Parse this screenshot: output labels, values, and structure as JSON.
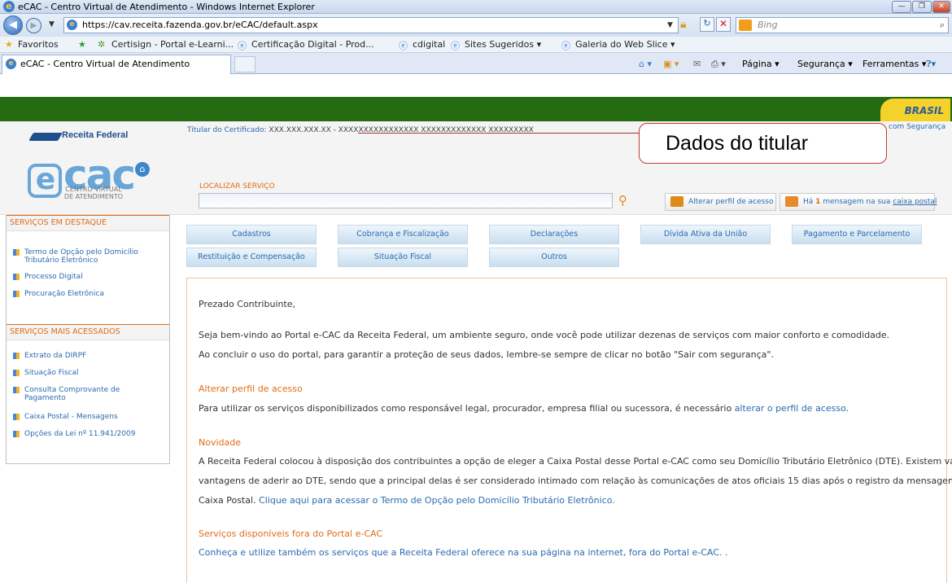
{
  "window": {
    "title": "eCAC - Centro Virtual de Atendimento - Windows Internet Explorer",
    "url": "https://cav.receita.fazenda.gov.br/eCAC/default.aspx",
    "search_placeholder": "Bing"
  },
  "favorites": {
    "label": "Favoritos",
    "items": [
      "Certisign - Portal e-Learni...",
      "Certificação Digital - Prod...",
      "cdigital",
      "Sites Sugeridos ▾",
      "Galeria do Web Slice ▾"
    ]
  },
  "tab": {
    "label": "eCAC - Centro Virtual de Atendimento"
  },
  "tools": {
    "page": "Página ▾",
    "security": "Segurança ▾",
    "tools": "Ferramentas ▾"
  },
  "site": {
    "brasil": "BRASIL",
    "receita": "Receita Federal",
    "ecac_logo": "cac",
    "centro": "CENTRO VIRTUAL\nDE ATENDIMENTO",
    "titular_label": "Titular do Certificado:",
    "titular_value": "XXX.XXX.XXX.XX - XXXXXXXXXXXXXXXX XXXXXXXXXXXXX XXXXXXXXX",
    "sair": "com Segurança",
    "callout": "Dados do titular"
  },
  "search": {
    "label": "LOCALIZAR SERVIÇO",
    "value": ""
  },
  "header_buttons": {
    "profile": "Alterar perfil de acesso",
    "mail_pre": "Há",
    "mail_count": "1",
    "mail_mid": "mensagem na sua",
    "mail_link": "caixa postal"
  },
  "sidebar": {
    "section1": "SERVIÇOS EM DESTAQUE",
    "items1": [
      "Termo de Opção pelo Domicílio Tributário Eletrônico",
      "Processo Digital",
      "Procuração Eletrônica"
    ],
    "section2": "SERVIÇOS MAIS ACESSADOS",
    "items2": [
      "Extrato da DIRPF",
      "Situação Fiscal",
      "Consulta Comprovante de Pagamento",
      "Caixa Postal - Mensagens",
      "Opções da Lei nº 11.941/2009"
    ]
  },
  "menu": {
    "row1": [
      "Cadastros",
      "Cobrança e Fiscalização",
      "Declarações",
      "Dívida Ativa da União",
      "Pagamento e Parcelamento"
    ],
    "row2": [
      "Restituição e Compensação",
      "Situação Fiscal",
      "Outros"
    ]
  },
  "content": {
    "greeting": "Prezado Contribuinte,",
    "p1": "Seja bem-vindo ao Portal e-CAC da Receita Federal, um ambiente seguro, onde você pode utilizar dezenas de serviços com maior conforto e comodidade.",
    "p2": "Ao concluir o uso do portal, para garantir a proteção de seus dados, lembre-se sempre de clicar no botão \"Sair com segurança\".",
    "h1": "Alterar perfil de acesso",
    "p3": "Para utilizar os serviços disponibilizados como responsável legal, procurador, empresa filial ou sucessora, é necessário",
    "p3_link": "alterar o perfil de acesso",
    "h2": "Novidade",
    "p4a": "A Receita Federal colocou à disposição dos contribuintes a opção de eleger a Caixa Postal desse Portal e-CAC como seu Domicílio Tributário Eletrônico (DTE). Existem várias",
    "p4b": "vantagens de aderir ao DTE, sendo que a principal delas é ser considerado intimado com relação às comunicações de atos oficiais 15 dias após o registro da mensagem na",
    "p4c": "Caixa Postal.",
    "p4_link": "Clique aqui para acessar o Termo de Opção pelo Domicílio Tributário Eletrônico.",
    "h3": "Serviços disponíveis fora do Portal e-CAC",
    "p5_link": "Conheça e utilize também os serviços que a Receita Federal oferece na sua página na internet, fora do Portal e-CAC. ."
  },
  "colors": {
    "accent": "#e06d17",
    "link": "#2a6ab0",
    "green": "#256b12"
  }
}
